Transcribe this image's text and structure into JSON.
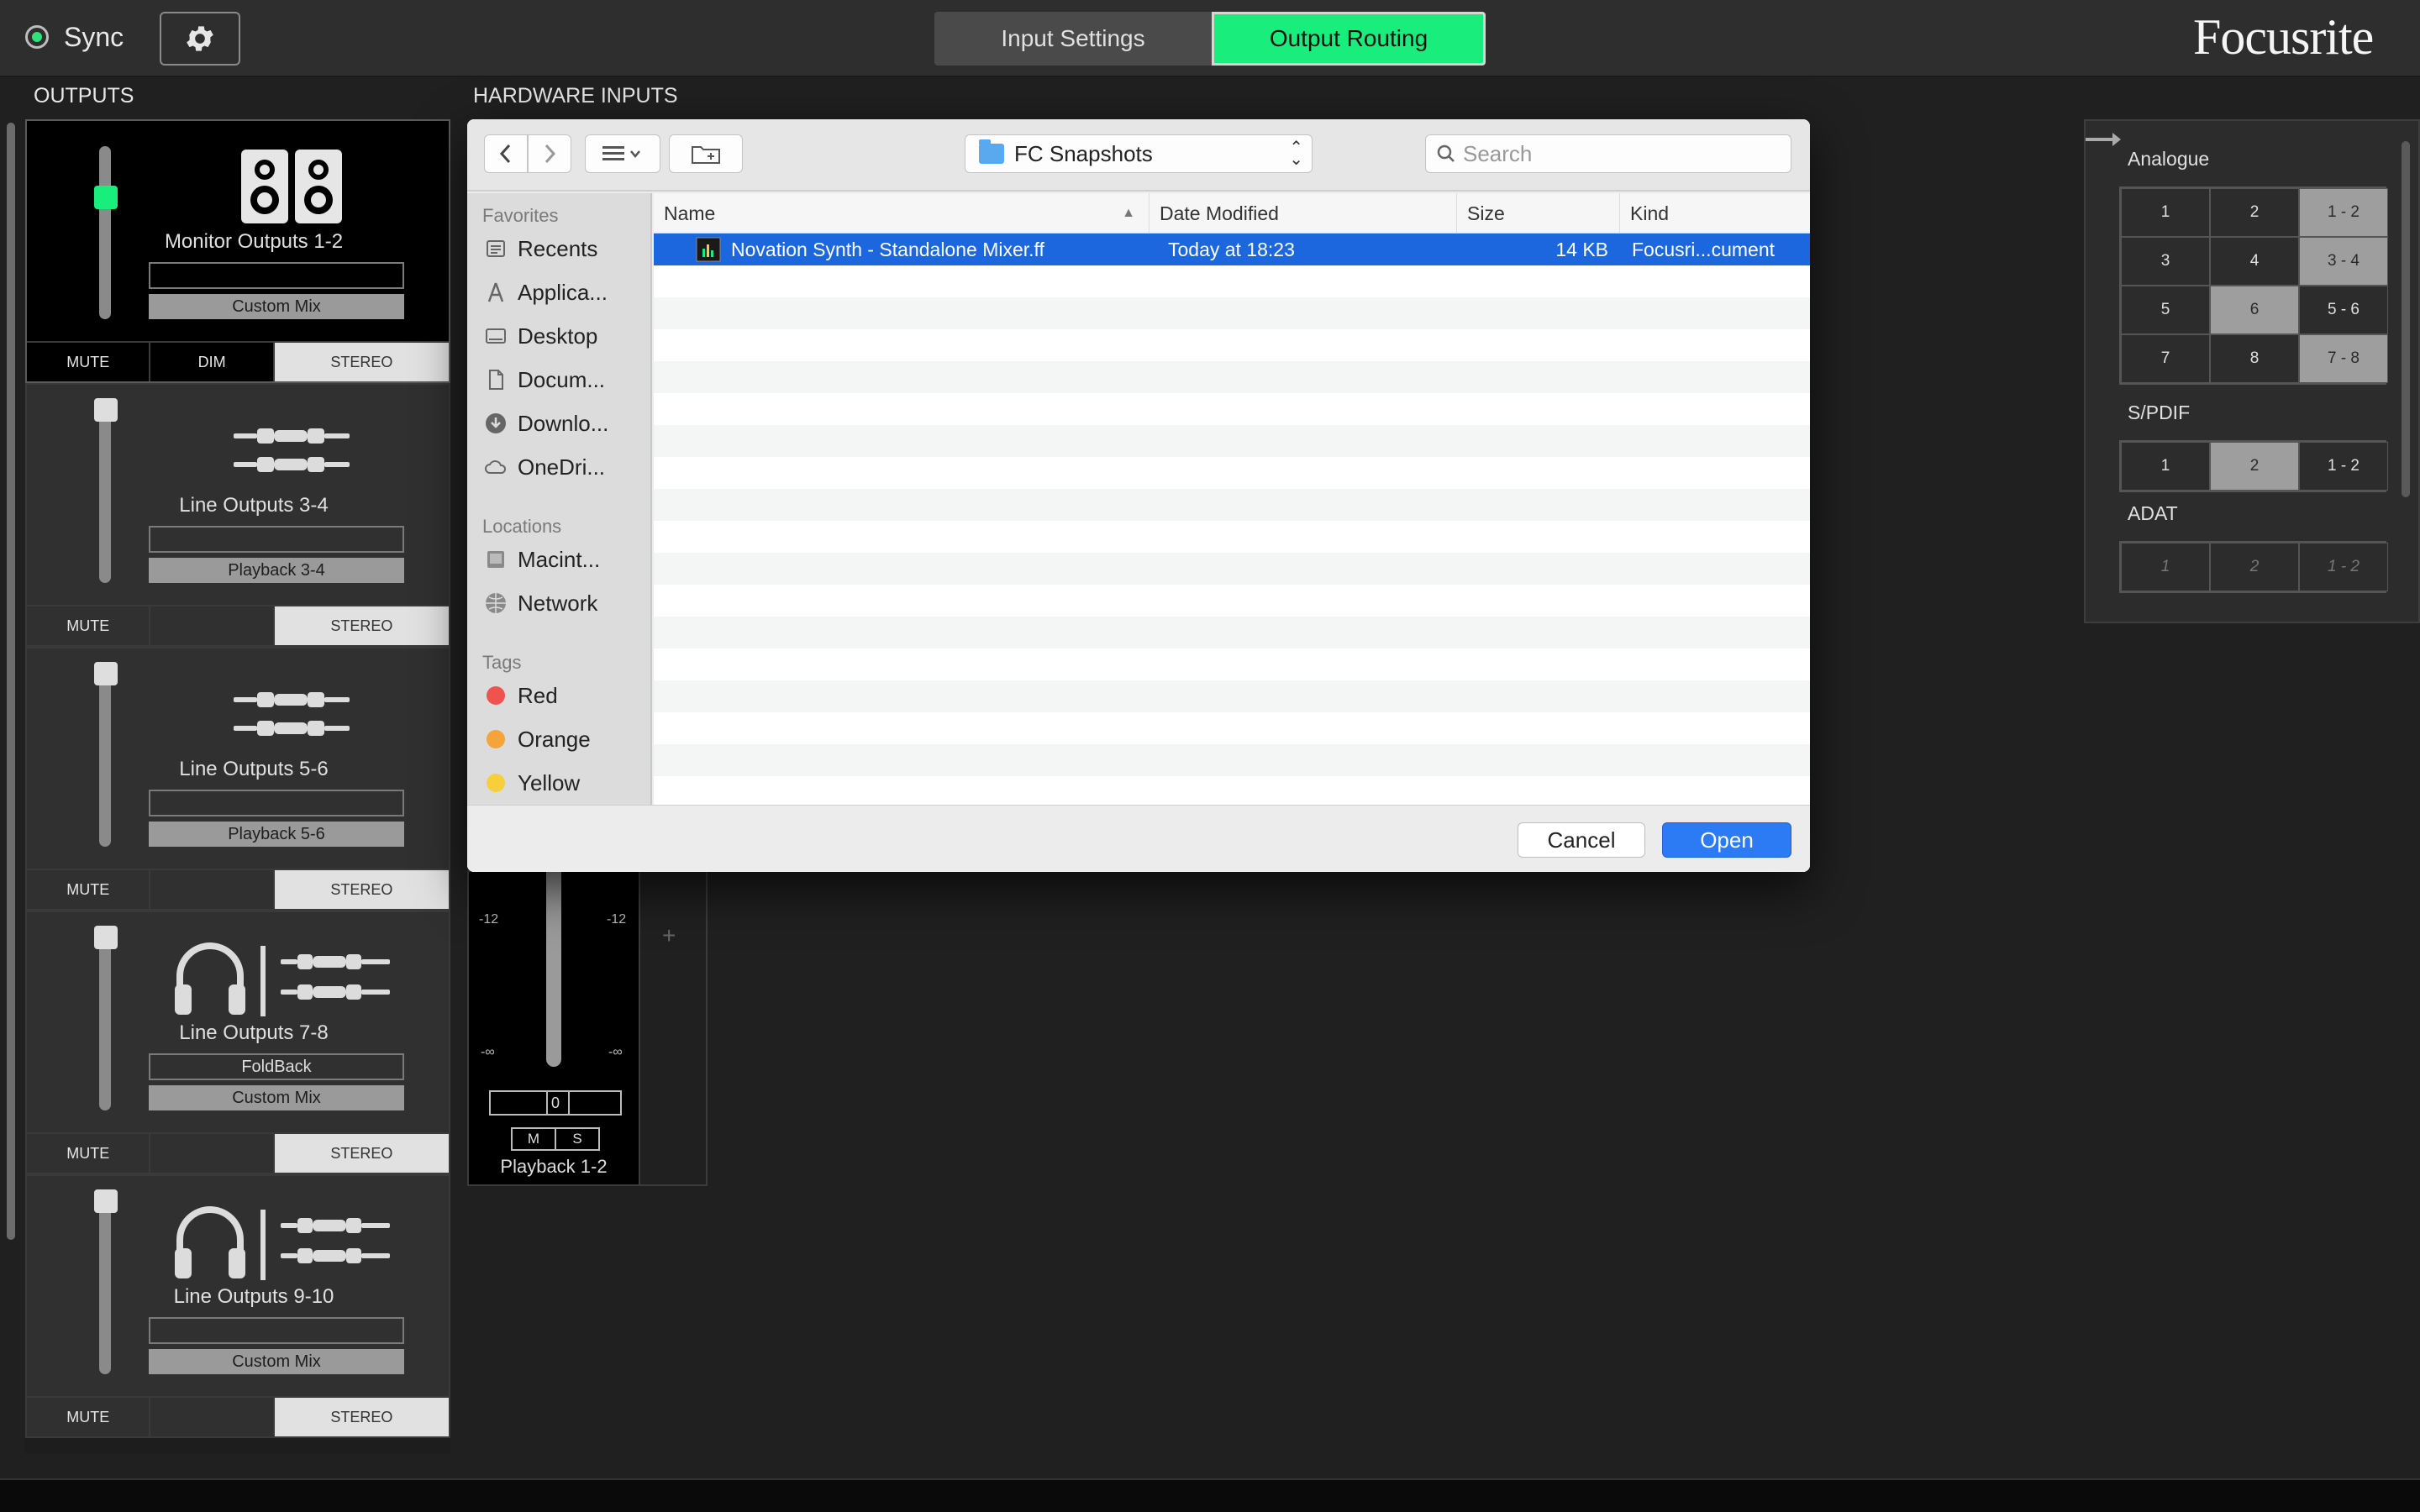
{
  "topbar": {
    "sync_label": "Sync",
    "tabs": [
      {
        "label": "Input Settings",
        "active": false
      },
      {
        "label": "Output Routing",
        "active": true
      }
    ],
    "brand": "Focusrite",
    "accent_color": "#19ee7c"
  },
  "outputs": {
    "title": "OUTPUTS",
    "strips": [
      {
        "name": "Monitor Outputs 1-2",
        "field": "",
        "source": "Custom Mix",
        "fader_level": 0.78,
        "buttons": [
          "MUTE",
          "DIM",
          "STEREO"
        ]
      },
      {
        "name": "Line Outputs 3-4",
        "field": "",
        "source": "Playback 3-4",
        "fader_level": 1.0,
        "buttons": [
          "MUTE",
          "STEREO"
        ]
      },
      {
        "name": "Line Outputs 5-6",
        "field": "",
        "source": "Playback 5-6",
        "fader_level": 1.0,
        "buttons": [
          "MUTE",
          "STEREO"
        ]
      },
      {
        "name": "Line Outputs 7-8",
        "field": "FoldBack",
        "source": "Custom Mix",
        "fader_level": 1.0,
        "buttons": [
          "MUTE",
          "STEREO"
        ]
      },
      {
        "name": "Line Outputs 9-10",
        "field": "",
        "source": "Custom Mix",
        "fader_level": 1.0,
        "buttons": [
          "MUTE",
          "STEREO"
        ]
      }
    ]
  },
  "hardware_inputs": {
    "title": "HARDWARE INPUTS",
    "analogue_label": "Analogue",
    "analogue": [
      [
        "1",
        "2",
        "1 - 2"
      ],
      [
        "3",
        "4",
        "3 - 4"
      ],
      [
        "5",
        "6",
        "5 - 6"
      ],
      [
        "7",
        "8",
        "7 - 8"
      ]
    ],
    "spdif_label": "S/PDIF",
    "spdif": [
      [
        "1",
        "2",
        "1 - 2"
      ]
    ],
    "adat_label": "ADAT",
    "adat": [
      [
        "1",
        "2",
        "1 - 2"
      ]
    ]
  },
  "mixer": {
    "scale_top": "-12",
    "scale_bottom": "-∞",
    "value": "0",
    "mute": "M",
    "solo": "S",
    "name": "Playback 1-2",
    "add": "+"
  },
  "dialog": {
    "path": "FC Snapshots",
    "search_placeholder": "Search",
    "sidebar": {
      "favorites_label": "Favorites",
      "favorites": [
        "Recents",
        "Applica...",
        "Desktop",
        "Docum...",
        "Downlo...",
        "OneDri..."
      ],
      "locations_label": "Locations",
      "locations": [
        "Macint...",
        "Network"
      ],
      "tags_label": "Tags",
      "tags": [
        {
          "name": "Red",
          "color": "#f0524f"
        },
        {
          "name": "Orange",
          "color": "#f5a33b"
        },
        {
          "name": "Yellow",
          "color": "#f7cf3b"
        }
      ]
    },
    "columns": {
      "name": "Name",
      "date": "Date Modified",
      "size": "Size",
      "kind": "Kind"
    },
    "files": [
      {
        "name": "Novation Synth - Standalone Mixer.ff",
        "date": "Today at 18:23",
        "size": "14 KB",
        "kind": "Focusri...cument",
        "selected": true
      }
    ],
    "cancel_label": "Cancel",
    "open_label": "Open",
    "selection_color": "#1c67dd"
  }
}
